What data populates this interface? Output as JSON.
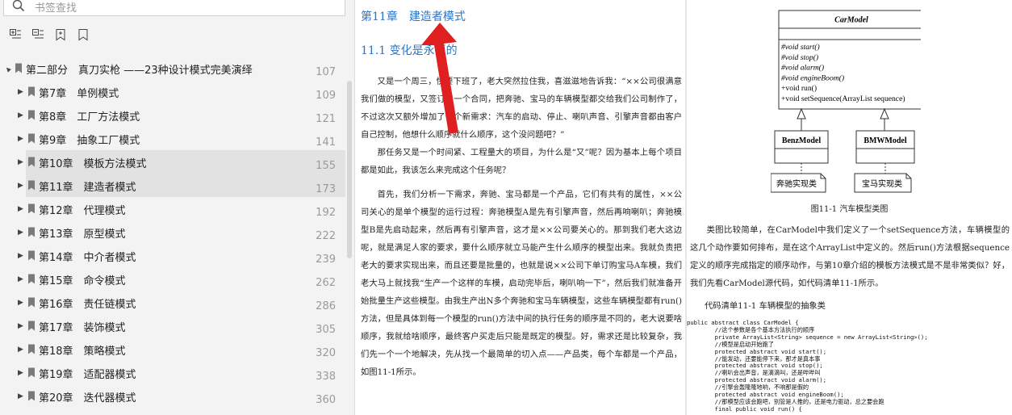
{
  "search": {
    "placeholder": "书签查找"
  },
  "toolbar": {
    "buttons": [
      "expand-all",
      "collapse-all",
      "add-bookmark",
      "bookmark"
    ]
  },
  "toc": [
    {
      "label": "第二部分　真刀实枪 ——23种设计模式完美演绎",
      "page": "107",
      "level": 0,
      "selected": false
    },
    {
      "label": "第7章　单例模式",
      "page": "109",
      "level": 1,
      "selected": false
    },
    {
      "label": "第8章　工厂方法模式",
      "page": "121",
      "level": 1,
      "selected": false
    },
    {
      "label": "第9章　抽象工厂模式",
      "page": "141",
      "level": 1,
      "selected": false
    },
    {
      "label": "第10章　模板方法模式",
      "page": "155",
      "level": 1,
      "selected": true
    },
    {
      "label": "第11章　建造者模式",
      "page": "173",
      "level": 1,
      "selected": true
    },
    {
      "label": "第12章　代理模式",
      "page": "192",
      "level": 1,
      "selected": false
    },
    {
      "label": "第13章　原型模式",
      "page": "222",
      "level": 1,
      "selected": false
    },
    {
      "label": "第14章　中介者模式",
      "page": "239",
      "level": 1,
      "selected": false
    },
    {
      "label": "第15章　命令模式",
      "page": "262",
      "level": 1,
      "selected": false
    },
    {
      "label": "第16章　责任链模式",
      "page": "286",
      "level": 1,
      "selected": false
    },
    {
      "label": "第17章　装饰模式",
      "page": "305",
      "level": 1,
      "selected": false
    },
    {
      "label": "第18章　策略模式",
      "page": "320",
      "level": 1,
      "selected": false
    },
    {
      "label": "第19章　适配器模式",
      "page": "338",
      "level": 1,
      "selected": false
    },
    {
      "label": "第20章　迭代器模式",
      "page": "360",
      "level": 1,
      "selected": false
    }
  ],
  "page1": {
    "chapter": "第11章　建造者模式",
    "section": "11.1 变化是永恒的",
    "paragraphs": [
      "又是一个周三，快要下班了，老大突然拉住我，喜滋滋地告诉我：“××公司很满意我们做的模型，又签订了一个合同，把奔驰、宝马的车辆模型都交给我们公司制作了，不过这次又额外增加了一个新需求：汽车的启动、停止、喇叭声音、引擎声音都由客户自己控制，他想什么顺序就什么顺序，这个没问题吧？”",
      "那任务又是一个时间紧、工程量大的项目，为什么是“又”呢？因为基本上每个项目都是如此，我该怎么来完成这个任务呢？",
      "首先，我们分析一下需求，奔驰、宝马都是一个产品，它们有共有的属性，××公司关心的是单个模型的运行过程：奔驰模型A是先有引擎声音，然后再响喇叭；奔驰模型B是先启动起来，然后再有引擎声音，这才是××公司要关心的。那到我们老大这边呢，就是满足人家的要求，要什么顺序就立马能产生什么顺序的模型出来。我就负责把老大的要求实现出来，而且还要是批量的，也就是说××公司下单订购宝马A车模，我们老大马上就找我“生产一个这样的车模，启动完毕后，喇叭响一下”，然后我们就准备开始批量生产这些模型。由我生产出N多个奔驰和宝马车辆模型，这些车辆模型都有run()方法，但是具体到每一个模型的run()方法中间的执行任务的顺序是不同的，老大说要啥顺序，我就给啥顺序，最终客户买走后只能是既定的模型。好，需求还是比较复杂，我们先一个一个地解决，先从找一个最简单的切入点——产品类，每个车都是一个产品，如图11-1所示。"
    ]
  },
  "uml": {
    "class_name": "CarModel",
    "methods": [
      "#void start()",
      "#void stop()",
      "#void alarm()",
      "#void engineBoom()",
      "+void run()",
      "+void setSequence(ArrayList sequence)"
    ],
    "subclasses": [
      "BenzModel",
      "BMWModel"
    ],
    "notes": [
      "奔驰实现类",
      "宝马实现类"
    ]
  },
  "page2": {
    "caption": "图11-1 汽车模型类图",
    "paragraph": "类图比较简单，在CarModel中我们定义了一个setSequence方法，车辆模型的这几个动作要如何排布，是在这个ArrayList中定义的。然后run()方法根据sequence定义的顺序完成指定的顺序动作，与第10章介绍的模板方法模式是不是非常类似？好，我们先看CarModel源代码，如代码清单11-1所示。",
    "code_title": "代码清单11-1 车辆模型的抽象类",
    "code_lines": [
      "public abstract class CarModel {",
      "        //这个参数是各个基本方法执行的顺序",
      "        private ArrayList<String> sequence = new ArrayList<String>();",
      "        //模型是启动开始跑了",
      "        protected abstract void start();",
      "        //能发动，还要能停下来，那才是真本事",
      "        protected abstract void stop();",
      "        //喇叭会出声音，是滴滴叫，还是哔哔叫",
      "        protected abstract void alarm();",
      "        //引擎会轰隆隆地响，不响那是假的",
      "        protected abstract void engineBoom();",
      "        //那模型应该会跑吧，别管是人推的，还是电力驱动，总之要会跑",
      "        final public void run() {"
    ]
  },
  "colors": {
    "accent": "#2b74c7",
    "selection": "#e2e2e2",
    "arrow": "#e02020"
  }
}
